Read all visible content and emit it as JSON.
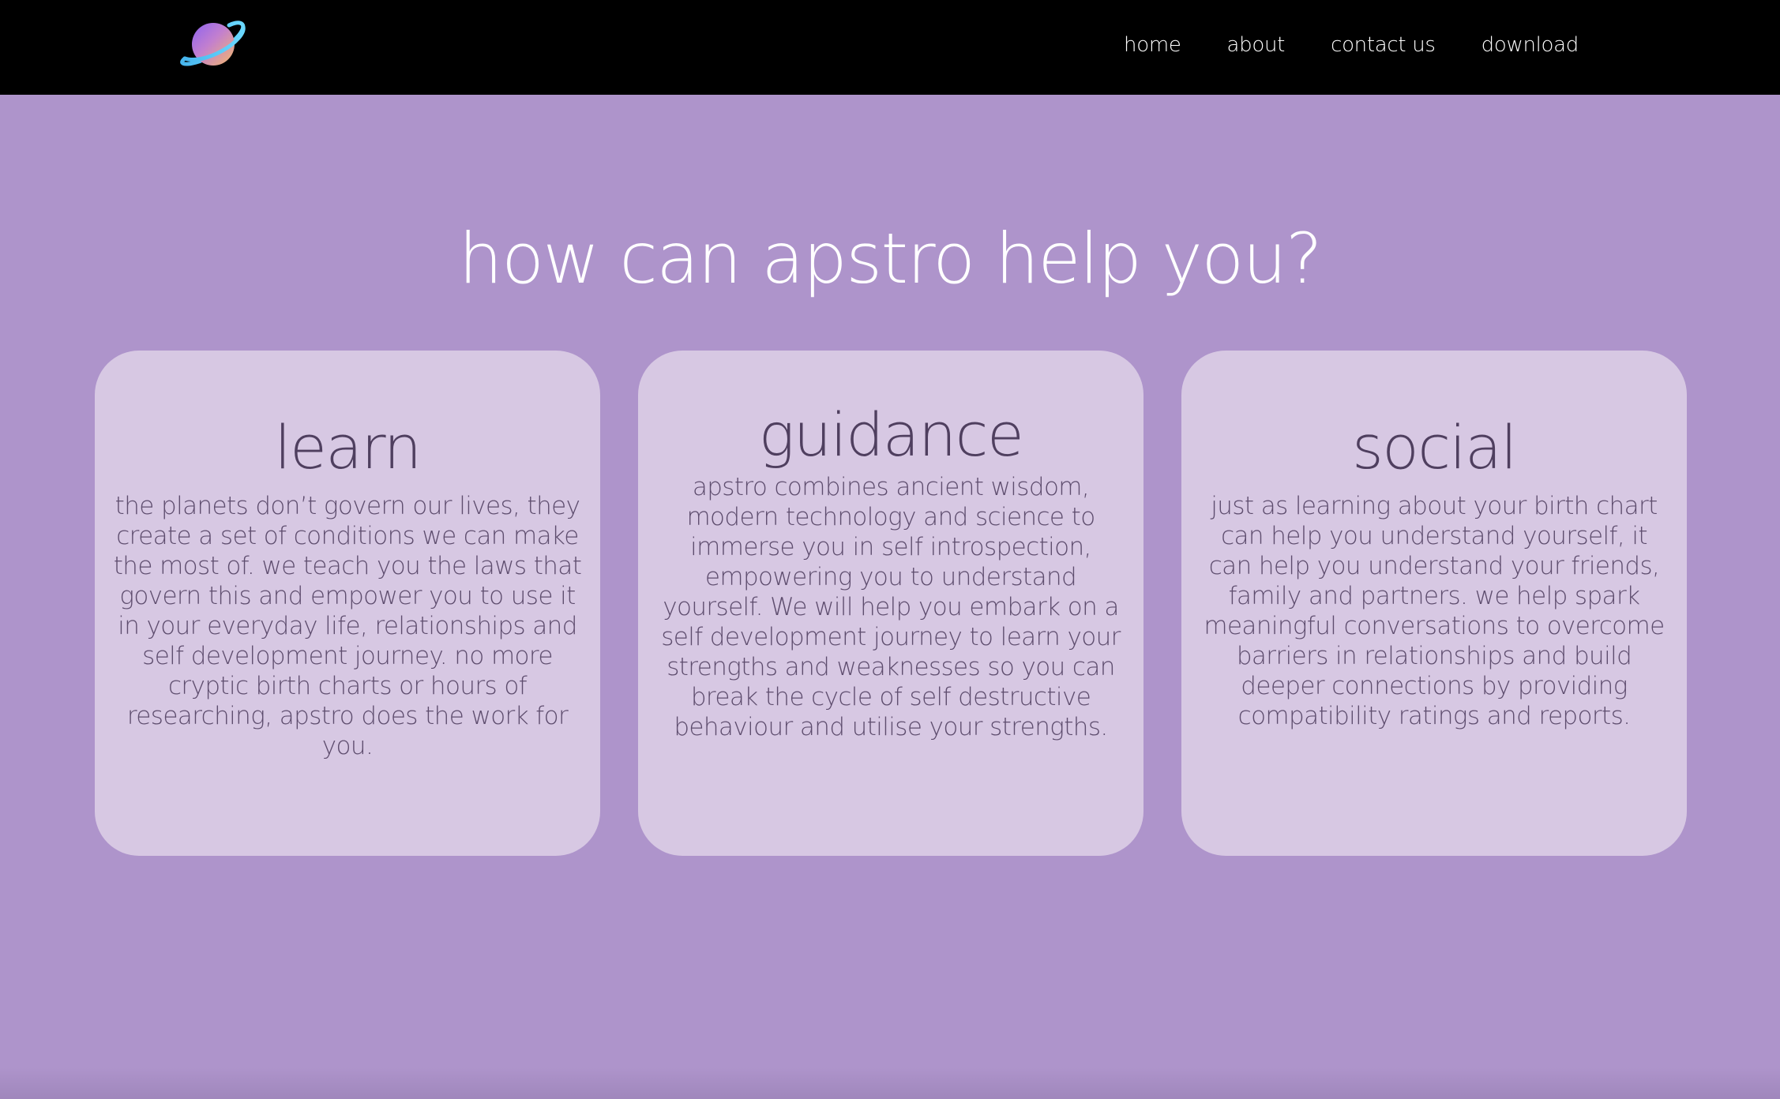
{
  "colors": {
    "navbar_bg": "#000000",
    "page_bg": "#ae94cb",
    "card_bg": "#d7c8e3",
    "title_text": "#ffffff",
    "card_heading_text": "#4f3f5f",
    "card_body_text": "#5e4d6e"
  },
  "navbar": {
    "logo": "planet-logo-icon",
    "links": [
      {
        "label": "home"
      },
      {
        "label": "about"
      },
      {
        "label": "contact us"
      },
      {
        "label": "download"
      }
    ]
  },
  "main": {
    "title": "how can apstro help you?",
    "cards": [
      {
        "heading": "learn",
        "text": "the planets don’t govern our lives, they create a set of conditions we can make the most of. we teach you the laws that govern this and empower you to use it in your everyday life, relationships and self development journey. no more cryptic birth charts or hours of researching, apstro does the work for you."
      },
      {
        "heading": "guidance",
        "text": "apstro combines ancient wisdom, modern technology and science to immerse you in self introspection, empowering you to understand yourself. We will help you embark on a self development journey to learn your strengths and weaknesses so you can break the cycle of self destructive behaviour and utilise your strengths."
      },
      {
        "heading": "social",
        "text": "just as learning about your birth chart can help you understand yourself, it can help you understand your friends, family and partners. we help spark meaningful conversations to overcome barriers in relationships and build deeper connections by providing compatibility ratings and reports."
      }
    ]
  }
}
